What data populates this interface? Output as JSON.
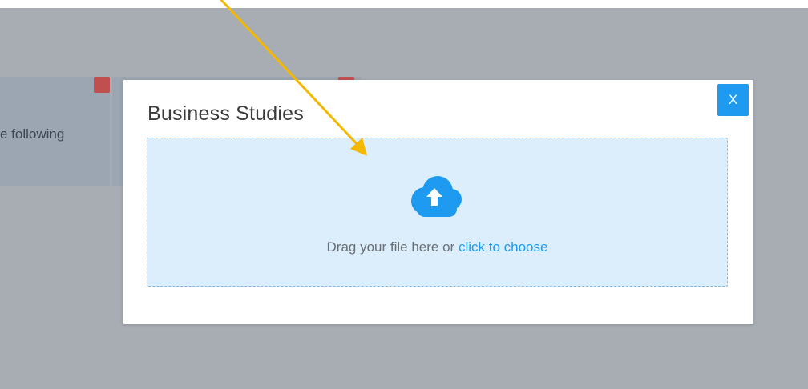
{
  "background": {
    "card_text": "e following"
  },
  "modal": {
    "title": "Business Studies",
    "close_label": "X",
    "dropzone": {
      "text": "Drag your file here or",
      "link_text": "click to choose",
      "icon": "cloud-upload-icon"
    }
  },
  "annotation": {
    "icon": "arrow-pointer",
    "color": "#f5b800"
  },
  "colors": {
    "accent": "#1e9bf0",
    "badge": "#c0504f",
    "dropzone_bg": "#dceefc",
    "overlay": "#a8adb4"
  }
}
